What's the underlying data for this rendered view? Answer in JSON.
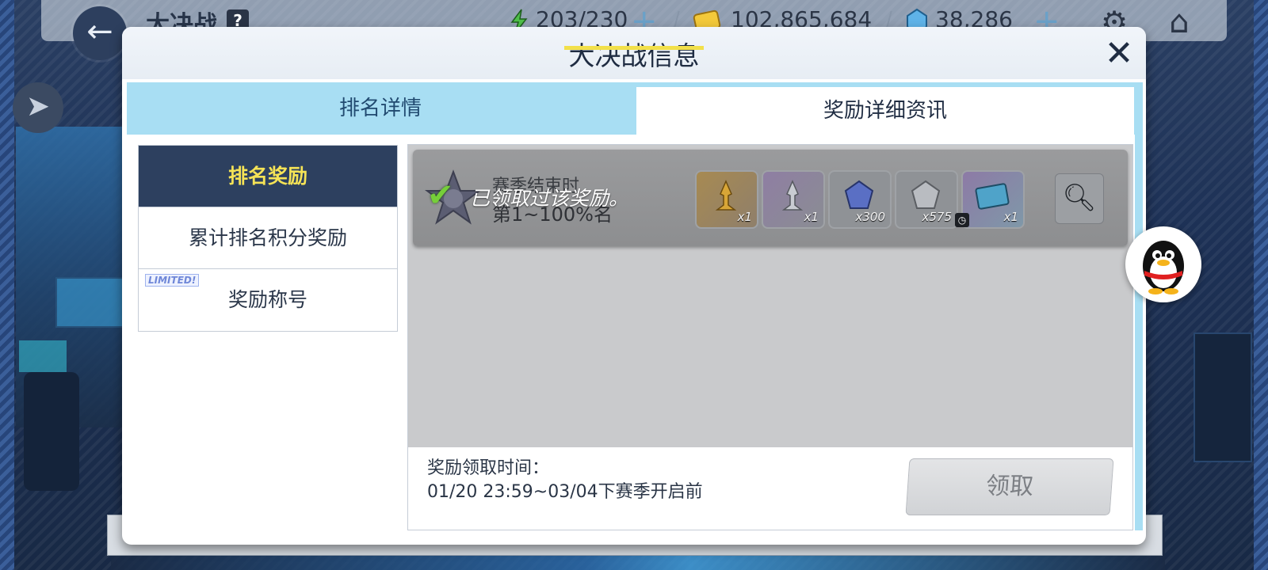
{
  "hud": {
    "title": "大决战",
    "help_label": "?",
    "stamina": "203/230",
    "gold": "102,865,684",
    "gems": "38,286",
    "plus_label": "+",
    "back_label": "←"
  },
  "dialog": {
    "title": "大决战信息",
    "close_label": "✕",
    "tabs": [
      {
        "label": "排名详情",
        "active": true
      },
      {
        "label": "奖励详细资讯",
        "active": false
      }
    ],
    "menu": [
      {
        "label": "排名奖励",
        "active": true
      },
      {
        "label": "累计排名积分奖励",
        "active": false
      },
      {
        "label": "奖励称号",
        "active": false,
        "badge": "LIMITED!"
      }
    ],
    "reward": {
      "rank_line1": "赛季结束时",
      "rank_line2": "第1~100%名",
      "claimed_message": "已领取过该奖励。",
      "items": [
        {
          "name": "golden-trophy",
          "count": "x1"
        },
        {
          "name": "silver-trophy",
          "count": "x1"
        },
        {
          "name": "blue-crystal",
          "count": "x300"
        },
        {
          "name": "silver-crystal",
          "count": "x575"
        },
        {
          "name": "ticket-card",
          "count": "x1"
        }
      ]
    },
    "claim_time_label": "奖励领取时间：",
    "claim_time_value": "01/20 23:59~03/04下赛季开启前",
    "claim_button": "领取"
  },
  "colors": {
    "tab_blue": "#a8def3",
    "menu_active": "#2d405f",
    "menu_active_text": "#f5e356",
    "title_underline": "#f2e04a",
    "check_green": "#76cf39"
  }
}
